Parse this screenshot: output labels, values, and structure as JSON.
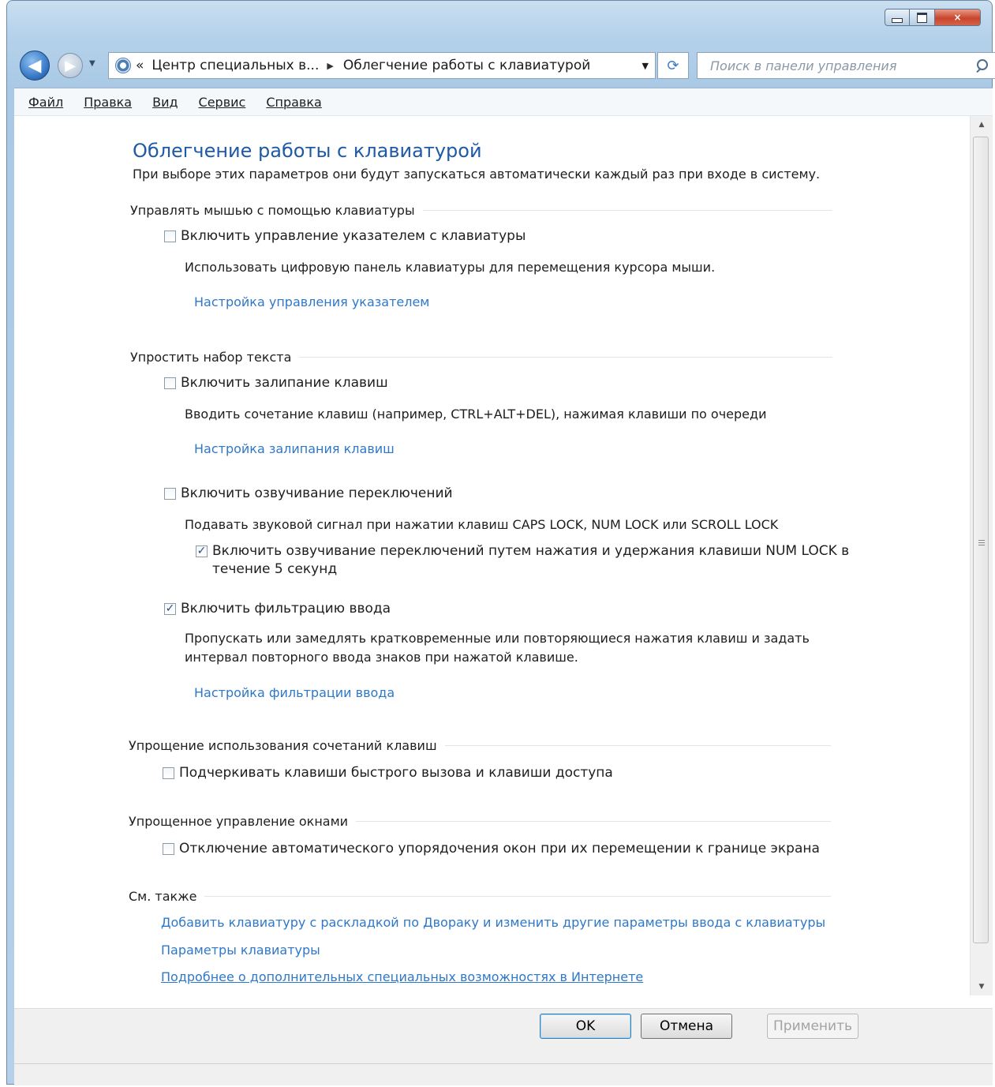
{
  "window": {
    "controls": {
      "minimize": "minimize",
      "maximize": "maximize",
      "close": "×"
    }
  },
  "nav": {
    "back_icon": "◀",
    "forward_icon": "▶",
    "breadcrumb": {
      "prefix": "«",
      "parent": "Центр специальных в...",
      "separator": "▶",
      "current": "Облегчение работы с клавиатурой"
    },
    "dropdown_icon": "▼",
    "refresh_icon": "⟳",
    "search_placeholder": "Поиск в панели управления"
  },
  "menubar": [
    "Файл",
    "Правка",
    "Вид",
    "Сервис",
    "Справка"
  ],
  "page": {
    "title": "Облегчение работы с клавиатурой",
    "description": "При выборе этих параметров они будут запускаться автоматически каждый раз при входе в систему."
  },
  "sections": {
    "mouse": {
      "heading": "Управлять мышью с помощью клавиатуры",
      "checkbox_label": "Включить управление указателем с клавиатуры",
      "checked": false,
      "description": "Использовать цифровую панель клавиатуры для перемещения курсора мыши.",
      "link": "Настройка управления указателем"
    },
    "typing": {
      "heading": "Упростить набор текста",
      "sticky": {
        "checkbox_label": "Включить залипание клавиш",
        "checked": false,
        "description": "Вводить сочетание клавиш (например, CTRL+ALT+DEL), нажимая клавиши по очереди",
        "link": "Настройка залипания клавиш"
      },
      "toggle": {
        "checkbox_label": "Включить озвучивание переключений",
        "checked": false,
        "description": "Подавать звуковой сигнал при нажатии клавиш CAPS LOCK, NUM LOCK или SCROLL LOCK",
        "sub_checkbox_label_line1": "Включить озвучивание переключений путем нажатия и удержания клавиши NUM LOCK в",
        "sub_checkbox_label_line2": "течение 5 секунд",
        "sub_checked": true
      },
      "filter": {
        "checkbox_label": "Включить фильтрацию ввода",
        "checked": true,
        "description_line1": "Пропускать или замедлять кратковременные или повторяющиеся нажатия клавиш и задать",
        "description_line2": "интервал повторного ввода знаков при нажатой клавише.",
        "link": "Настройка фильтрации ввода"
      }
    },
    "shortcuts": {
      "heading": "Упрощение использования сочетаний клавиш",
      "checkbox_label": "Подчеркивать клавиши быстрого вызова и клавиши доступа",
      "checked": false
    },
    "windows": {
      "heading": "Упрощенное управление окнами",
      "checkbox_label": "Отключение автоматического упорядочения окон при их перемещении к границе экрана",
      "checked": false
    },
    "see_also": {
      "heading": "См. также",
      "links": [
        "Добавить клавиатуру с раскладкой по Двораку и изменить другие параметры ввода с клавиатуры",
        "Параметры клавиатуры",
        "Подробнее о дополнительных специальных возможностях в Интернете"
      ]
    }
  },
  "buttons": {
    "ok": "OK",
    "cancel": "Отмена",
    "apply": "Применить"
  },
  "check_mark": "✓"
}
